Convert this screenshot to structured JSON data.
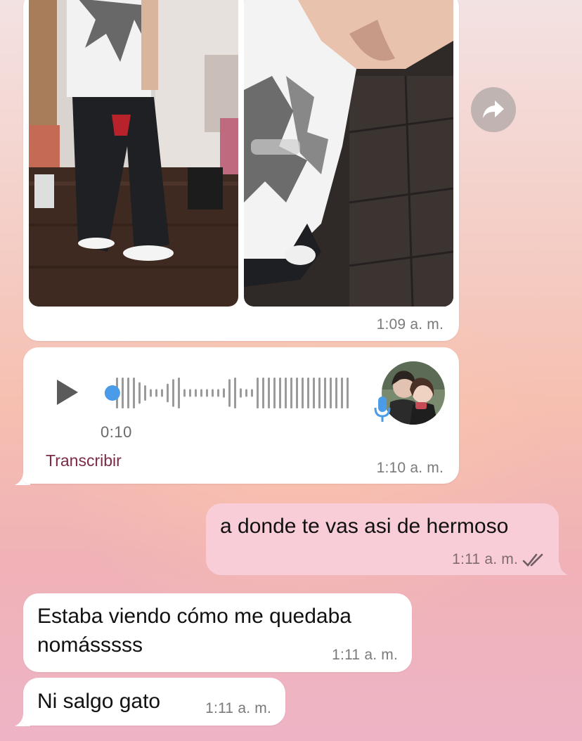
{
  "photo_message": {
    "time": "1:09 a. m."
  },
  "voice_message": {
    "duration": "0:10",
    "transcribe_label": "Transcribir",
    "time": "1:10 a. m.",
    "waveform_level": 0.02
  },
  "outgoing": [
    {
      "text": "a donde te vas asi de hermoso",
      "time": "1:11 a. m.",
      "status_icon": "double-check-icon"
    }
  ],
  "incoming": [
    {
      "text": "Estaba viendo cómo me quedaba nomásssss",
      "time": "1:11 a. m."
    },
    {
      "text": "Ni salgo gato",
      "time": "1:11 a. m."
    }
  ],
  "icons": {
    "forward": "forward-share-icon",
    "play": "play-icon",
    "mic": "microphone-icon"
  },
  "colors": {
    "outgoing_bubble": "#f9cdd7",
    "incoming_bubble": "#ffffff",
    "transcribe_link": "#7c2a46",
    "voice_accent": "#4a9be8"
  }
}
